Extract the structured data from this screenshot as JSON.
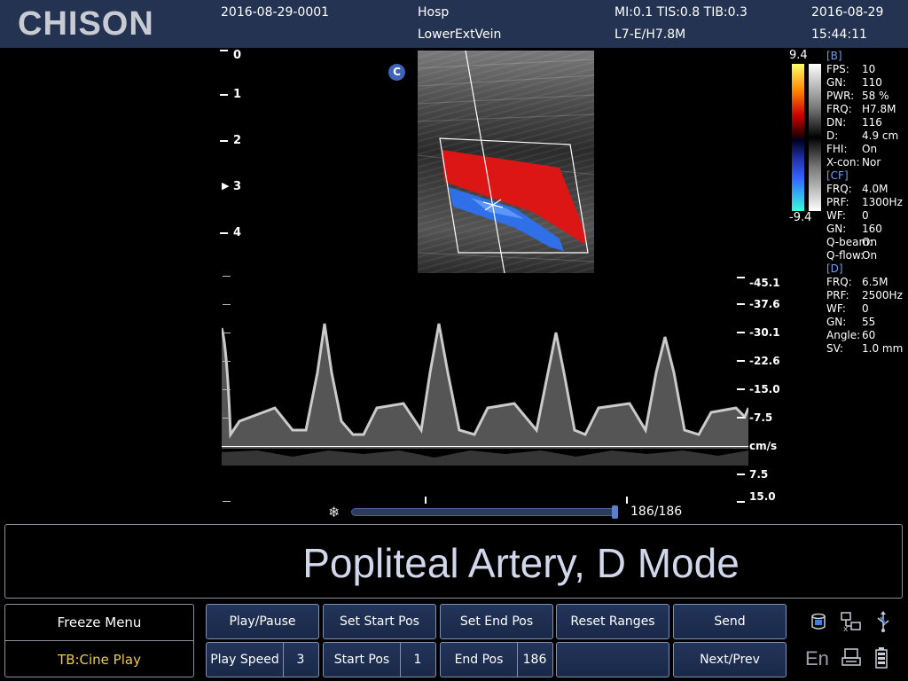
{
  "header": {
    "logo": "CHISON",
    "patient_id": "2016-08-29-0001",
    "hospital": "Hosp",
    "exam": "LowerExtVein",
    "indices": "MI:0.1  TIS:0.8  TIB:0.3",
    "probe": "L7-E/H7.8M",
    "date": "2016-08-29",
    "time": "15:44:11"
  },
  "depth_scale": {
    "labels": [
      "0",
      "1",
      "2",
      "3",
      "4"
    ]
  },
  "color_flow_badge": "C",
  "color_bar": {
    "max": "9.4",
    "min": "-9.4"
  },
  "params": {
    "b": {
      "header": "[B]",
      "rows": [
        {
          "label": "FPS:",
          "value": "10"
        },
        {
          "label": "GN:",
          "value": "110"
        },
        {
          "label": "PWR:",
          "value": "58 %"
        },
        {
          "label": "FRQ:",
          "value": "H7.8M"
        },
        {
          "label": "DN:",
          "value": "116"
        },
        {
          "label": "D:",
          "value": "4.9 cm"
        },
        {
          "label": "FHI:",
          "value": "On"
        },
        {
          "label": "X-con:",
          "value": "Nor"
        }
      ]
    },
    "cf": {
      "header": "[CF]",
      "rows": [
        {
          "label": "FRQ:",
          "value": "4.0M"
        },
        {
          "label": "PRF:",
          "value": "1300Hz"
        },
        {
          "label": "WF:",
          "value": "0"
        },
        {
          "label": "GN:",
          "value": "160"
        },
        {
          "label": "Q-beam:",
          "value": "On"
        },
        {
          "label": "Q-flow:",
          "value": "On"
        }
      ]
    },
    "d": {
      "header": "[D]",
      "rows": [
        {
          "label": "FRQ:",
          "value": "6.5M"
        },
        {
          "label": "PRF:",
          "value": "2500Hz"
        },
        {
          "label": "WF:",
          "value": "0"
        },
        {
          "label": "GN:",
          "value": "55"
        },
        {
          "label": "Angle:",
          "value": "60"
        },
        {
          "label": "SV:",
          "value": "1.0 mm"
        }
      ]
    }
  },
  "velocity_scale": {
    "labels": [
      "-45.1",
      "-37.6",
      "-30.1",
      "-22.6",
      "-15.0",
      "-7.5",
      "cm/s",
      "7.5",
      "15.0"
    ]
  },
  "cine": {
    "frame_count": "186/186",
    "position": 1.0
  },
  "annotation": "Popliteal Artery, D Mode",
  "menu": {
    "title": "Freeze Menu",
    "subtitle": "TB:Cine Play",
    "top_buttons": [
      "Play/Pause",
      "Set Start Pos",
      "Set End Pos",
      "Reset Ranges",
      "Send"
    ],
    "play_speed": {
      "label": "Play Speed",
      "value": "3"
    },
    "start_pos": {
      "label": "Start Pos",
      "value": "1"
    },
    "end_pos": {
      "label": "End Pos",
      "value": "186"
    },
    "next_prev": "Next/Prev"
  },
  "system": {
    "language": "En"
  },
  "colors": {
    "header_bg": "#243351",
    "button_bg": "#1e2f52",
    "accent_yellow": "#f0c94a",
    "annotation_text": "#d2d8ec"
  }
}
